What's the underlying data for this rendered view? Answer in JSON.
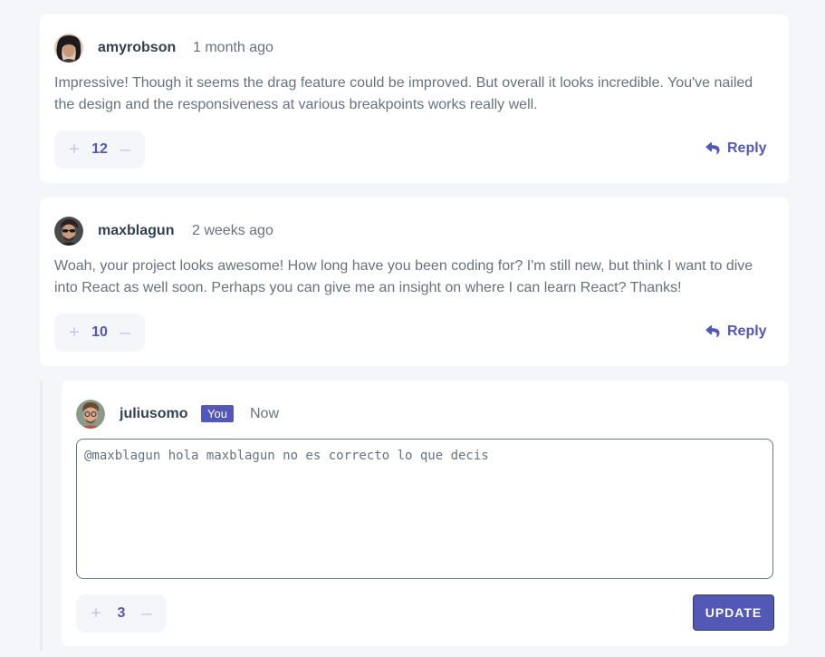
{
  "colors": {
    "accent": "#5357b6",
    "accent_light": "#c5c6ef",
    "text_dark": "#324152",
    "text_muted": "#67727e",
    "background": "#f5f6fa"
  },
  "comments": [
    {
      "username": "amyrobson",
      "timestamp": "1 month ago",
      "content": "Impressive! Though it seems the drag feature could be improved. But overall it looks incredible. You've nailed the design and the responsiveness at various breakpoints works really well.",
      "score": "12",
      "reply_label": "Reply",
      "avatar_icon": "avatar-amyrobson"
    },
    {
      "username": "maxblagun",
      "timestamp": "2 weeks ago",
      "content": "Woah, your project looks awesome! How long have you been coding for? I'm still new, but think I want to dive into React as well soon. Perhaps you can give me an insight on where I can learn React? Thanks!",
      "score": "10",
      "reply_label": "Reply",
      "avatar_icon": "avatar-maxblagun"
    }
  ],
  "editing_reply": {
    "username": "juliusomo",
    "you_badge": "You",
    "timestamp": "Now",
    "text_value": "@maxblagun hola maxblagun no es correcto lo que decis",
    "score": "3",
    "update_label": "UPDATE",
    "avatar_icon": "avatar-juliusomo"
  },
  "vote_icons": {
    "upvote": "+",
    "downvote": "–"
  }
}
